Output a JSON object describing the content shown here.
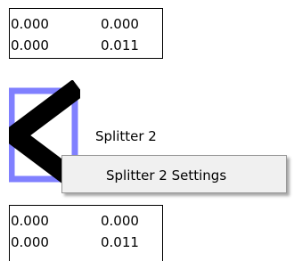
{
  "top_values": {
    "row1": [
      "0.000",
      "0.000"
    ],
    "row2": [
      "0.000",
      "0.011"
    ]
  },
  "splitter": {
    "label": "Splitter 2",
    "icon": "splitter-icon",
    "frame_color": "#8080ff",
    "glyph_color": "#000000"
  },
  "context_menu": {
    "items": [
      {
        "label": "Splitter 2 Settings"
      }
    ]
  },
  "bottom_values": {
    "row1": [
      "0.000",
      "0.000"
    ],
    "row2": [
      "0.000",
      "0.011"
    ]
  }
}
